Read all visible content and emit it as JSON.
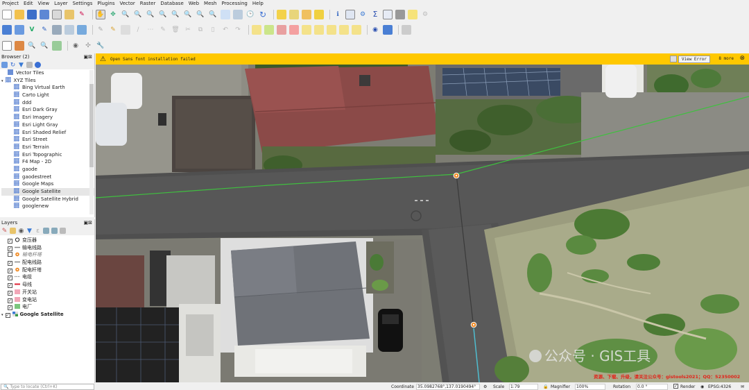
{
  "menu": [
    "Project",
    "Edit",
    "View",
    "Layer",
    "Settings",
    "Plugins",
    "Vector",
    "Raster",
    "Database",
    "Web",
    "Mesh",
    "Processing",
    "Help"
  ],
  "browser": {
    "title": "Browser (2)",
    "items": [
      {
        "label": "Vector Tiles",
        "indent": 0,
        "icon": "vector-tiles-icon"
      },
      {
        "label": "XYZ Tiles",
        "indent": 0,
        "icon": "xyz-icon",
        "expanded": true
      },
      {
        "label": "Bing Virtual Earth",
        "indent": 1
      },
      {
        "label": "Carto Light",
        "indent": 1
      },
      {
        "label": "ddd",
        "indent": 1
      },
      {
        "label": "Esri Dark Gray",
        "indent": 1
      },
      {
        "label": "Esri Imagery",
        "indent": 1
      },
      {
        "label": "Esri Light Gray",
        "indent": 1
      },
      {
        "label": "Esri Shaded Relief",
        "indent": 1
      },
      {
        "label": "Esri Street",
        "indent": 1
      },
      {
        "label": "Esri Terrain",
        "indent": 1
      },
      {
        "label": "Esri Topographic",
        "indent": 1
      },
      {
        "label": "F4 Map - 2D",
        "indent": 1
      },
      {
        "label": "gaode",
        "indent": 1
      },
      {
        "label": "gaodestreet",
        "indent": 1
      },
      {
        "label": "Google Maps",
        "indent": 1
      },
      {
        "label": "Google Satellite",
        "indent": 1,
        "selected": true
      },
      {
        "label": "Google Satellite Hybrid",
        "indent": 1
      },
      {
        "label": "googlenew",
        "indent": 1
      }
    ]
  },
  "layers": {
    "title": "Layers",
    "items": [
      {
        "label": "变压器",
        "checked": true,
        "sym": "circle-black"
      },
      {
        "label": "输电线路",
        "checked": true,
        "sym": "line-gray"
      },
      {
        "label": "输电杆塔",
        "checked": false,
        "sym": "circle-orange",
        "italic": true
      },
      {
        "label": "配电线路",
        "checked": true,
        "sym": "line-gray"
      },
      {
        "label": "配电杆塔",
        "checked": true,
        "sym": "circle-orange"
      },
      {
        "label": "电缆",
        "checked": true,
        "sym": "dash-gray"
      },
      {
        "label": "母线",
        "checked": true,
        "sym": "bar-red"
      },
      {
        "label": "开关站",
        "checked": true,
        "sym": "fill-pink"
      },
      {
        "label": "变电站",
        "checked": true,
        "sym": "fill-pink"
      },
      {
        "label": "电厂",
        "checked": true,
        "sym": "fill-green"
      },
      {
        "label": "Google Satellite",
        "checked": true,
        "sym": "raster",
        "bold": true
      }
    ]
  },
  "message": {
    "text": "Open Sans font installation failed",
    "button": "View Error",
    "more": "8 more"
  },
  "watermark": {
    "brand": "公众号 · GIS工具",
    "red_note": "资源、下载、升级，请关注公众号：gistools2021；QQ：52350002"
  },
  "status": {
    "search_placeholder": "Type to locate (Ctrl+K)",
    "coord_label": "Coordinate",
    "coord_value": "35.0982768°,137.0190494°",
    "scale_label": "Scale",
    "scale_value": "1:79",
    "magnifier_label": "Magnifier",
    "magnifier_value": "100%",
    "rotation_label": "Rotation",
    "rotation_value": "0.0 °",
    "render_label": "Render",
    "crs": "EPSG:4326"
  }
}
